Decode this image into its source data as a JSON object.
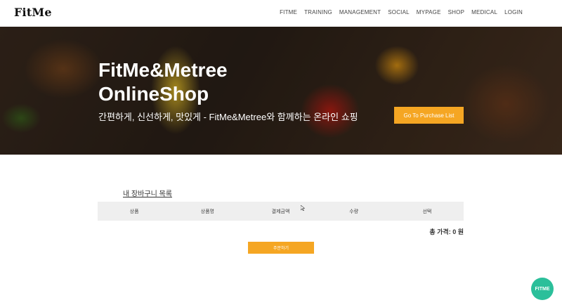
{
  "header": {
    "logo": "FitMe",
    "nav": [
      "FITME",
      "TRAINING",
      "MANAGEMENT",
      "SOCIAL",
      "MYPAGE",
      "SHOP",
      "MEDICAL",
      "LOGIN"
    ]
  },
  "hero": {
    "title_line1": "FitMe&Metree",
    "title_line2": "OnlineShop",
    "subtitle": "간편하게, 신선하게, 맛있게 - FitMe&Metree와 함께하는 온라인 쇼핑",
    "button_label": "Go To Purchase List"
  },
  "cart": {
    "title": "내 장바구니 목록",
    "columns": [
      "상품",
      "상품명",
      "결제금액",
      "수량",
      "선택"
    ],
    "total": "총 가격: 0 원",
    "order_button": "주문하기"
  },
  "fab": {
    "label": "FITME"
  },
  "colors": {
    "accent": "#f5a623",
    "fab": "#2bbf9a",
    "table_header": "#efefef"
  }
}
